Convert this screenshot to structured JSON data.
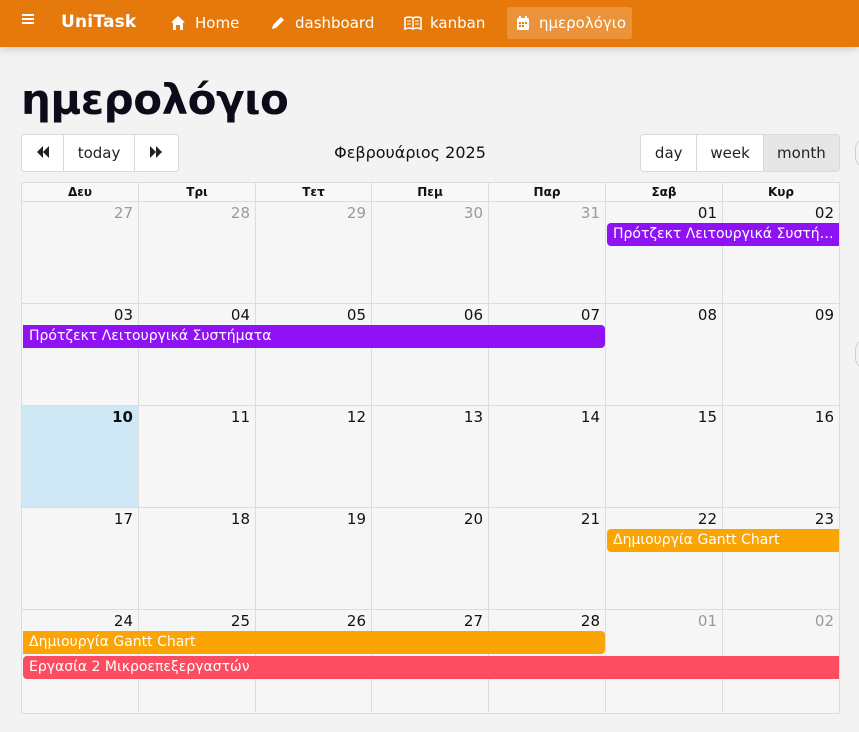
{
  "navbar": {
    "brand": "UniTask",
    "items": [
      {
        "label": "Home",
        "icon": "home-icon"
      },
      {
        "label": "dashboard",
        "icon": "pencil-icon"
      },
      {
        "label": "kanban",
        "icon": "book-icon"
      },
      {
        "label": "ημερολόγιο",
        "icon": "calendar-icon",
        "active": true
      }
    ]
  },
  "page": {
    "title": "ημερολόγιο"
  },
  "toolbar": {
    "prev_icon": "double-left-arrow-icon",
    "today_label": "today",
    "next_icon": "double-right-arrow-icon",
    "title": "Φεβρουάριος 2025",
    "views": [
      "day",
      "week",
      "month"
    ],
    "active_view": "month"
  },
  "calendar": {
    "weekdays": [
      "Δευ",
      "Τρι",
      "Τετ",
      "Πεμ",
      "Παρ",
      "Σαβ",
      "Κυρ"
    ],
    "weeks": [
      [
        {
          "d": "27",
          "other": true
        },
        {
          "d": "28",
          "other": true
        },
        {
          "d": "29",
          "other": true
        },
        {
          "d": "30",
          "other": true
        },
        {
          "d": "31",
          "other": true
        },
        {
          "d": "01"
        },
        {
          "d": "02"
        }
      ],
      [
        {
          "d": "03"
        },
        {
          "d": "04"
        },
        {
          "d": "05"
        },
        {
          "d": "06"
        },
        {
          "d": "07"
        },
        {
          "d": "08"
        },
        {
          "d": "09"
        }
      ],
      [
        {
          "d": "10",
          "today": true
        },
        {
          "d": "11"
        },
        {
          "d": "12"
        },
        {
          "d": "13"
        },
        {
          "d": "14"
        },
        {
          "d": "15"
        },
        {
          "d": "16"
        }
      ],
      [
        {
          "d": "17"
        },
        {
          "d": "18"
        },
        {
          "d": "19"
        },
        {
          "d": "20"
        },
        {
          "d": "21"
        },
        {
          "d": "22"
        },
        {
          "d": "23"
        }
      ],
      [
        {
          "d": "24"
        },
        {
          "d": "25"
        },
        {
          "d": "26"
        },
        {
          "d": "27"
        },
        {
          "d": "28"
        },
        {
          "d": "01",
          "other": true
        },
        {
          "d": "02",
          "other": true
        }
      ]
    ],
    "events": [
      {
        "week": 0,
        "start": 5,
        "end": 6,
        "lane": 0,
        "title": "Πρότζεκτ Λειτουργικά Συστήματα",
        "color": "#8f12f5",
        "contRight": true
      },
      {
        "week": 1,
        "start": 0,
        "end": 4,
        "lane": 0,
        "title": "Πρότζεκτ Λειτουργικά Συστήματα",
        "color": "#8f12f5",
        "contLeft": true
      },
      {
        "week": 3,
        "start": 5,
        "end": 6,
        "lane": 0,
        "title": "Δημιουργία Gantt Chart",
        "color": "#fba405",
        "contRight": true
      },
      {
        "week": 4,
        "start": 0,
        "end": 4,
        "lane": 0,
        "title": "Δημιουργία Gantt Chart",
        "color": "#fba405",
        "contLeft": true
      },
      {
        "week": 4,
        "start": 0,
        "end": 6,
        "lane": 1,
        "title": "Εργασία 2 Μικροεπεξεργαστών",
        "color": "#fb4d5f",
        "contRight": true
      }
    ]
  }
}
